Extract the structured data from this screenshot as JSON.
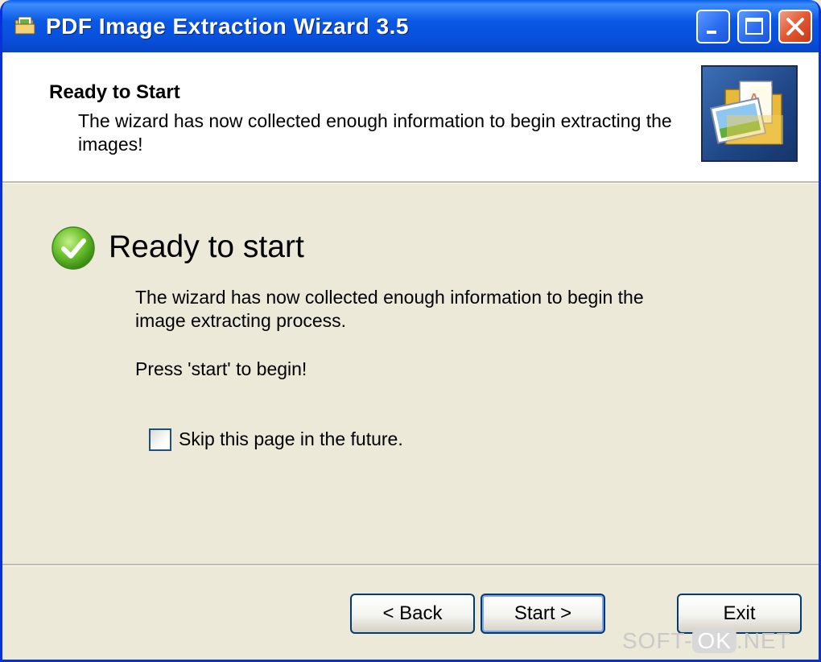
{
  "window": {
    "title": "PDF Image Extraction Wizard 3.5",
    "controls": [
      "minimize",
      "maximize",
      "close"
    ]
  },
  "header": {
    "title": "Ready to Start",
    "description": "The wizard has now collected enough information to begin extracting the images!",
    "image_icon": "folder-pdf-image-icon"
  },
  "main": {
    "status_icon": "green-check-icon",
    "title": "Ready to start",
    "description": "The wizard has now collected enough information to begin the image extracting process.",
    "prompt": "Press 'start' to begin!",
    "skip_checkbox": {
      "label": "Skip this page in the future.",
      "checked": false
    }
  },
  "buttons": {
    "back": "< Back",
    "start": "Start >",
    "exit": "Exit"
  },
  "watermark": {
    "part1": "SOFT-",
    "part2": "OK",
    "part3": ".NET"
  },
  "colors": {
    "titlebar": "#0750DB",
    "dialog_bg": "#ECE9D8",
    "header_bg": "#FFFFFF",
    "close_button": "#E3562F",
    "check_green": "#5CB82B"
  }
}
